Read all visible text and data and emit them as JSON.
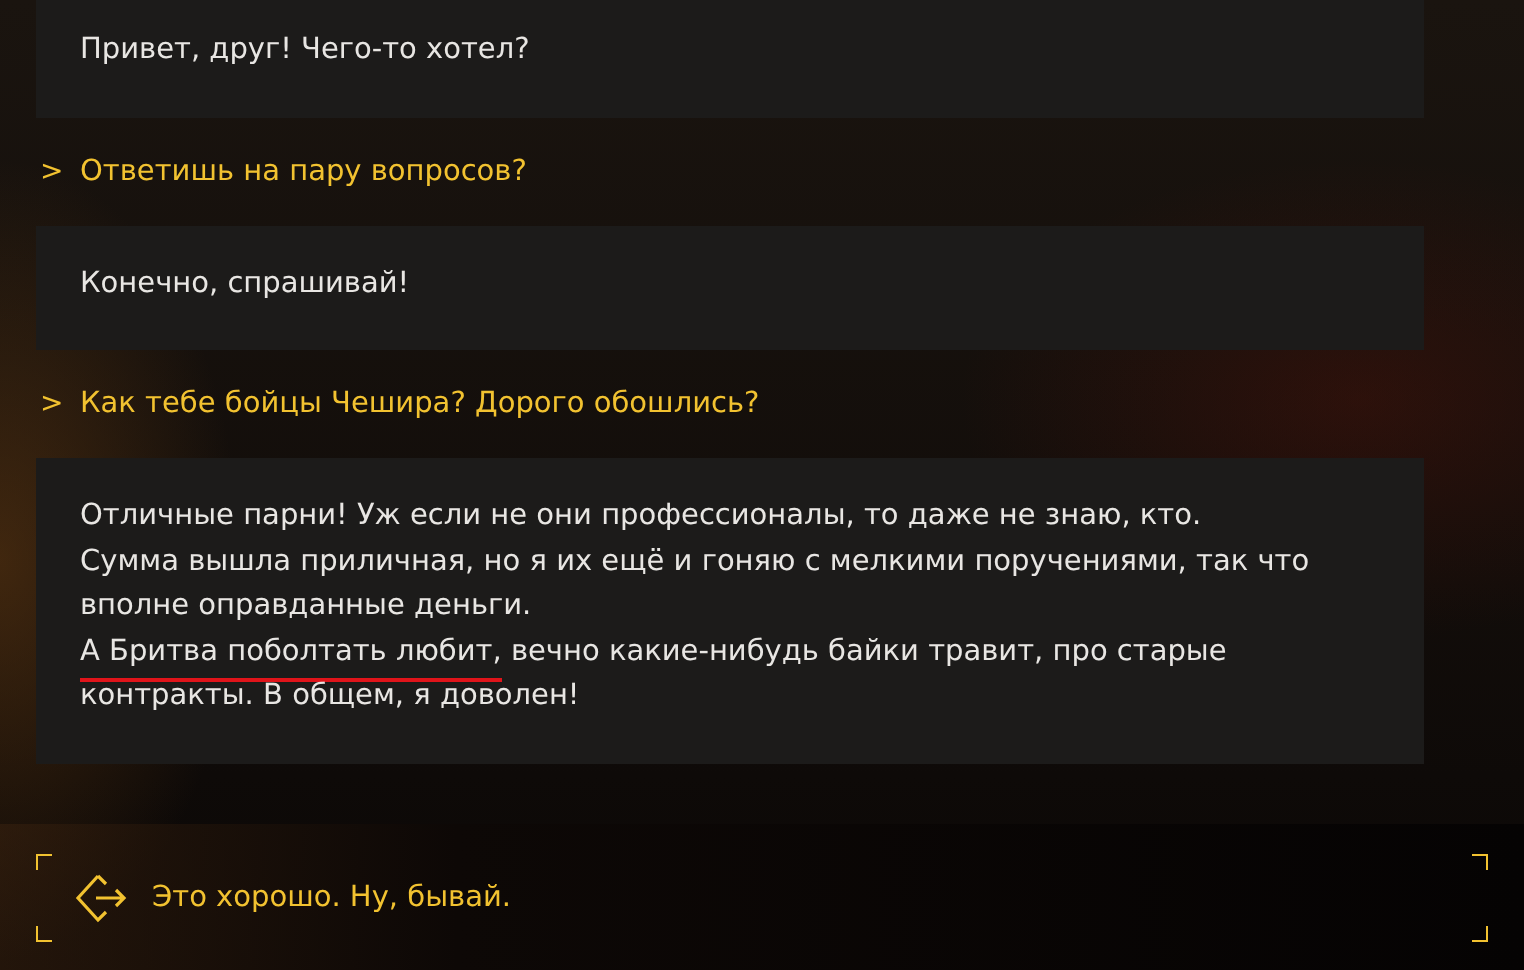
{
  "dialogue": [
    {
      "kind": "npc",
      "lines": [
        [
          {
            "text": "Привет, друг! Чего-то хотел?",
            "underlined": false
          }
        ]
      ]
    },
    {
      "kind": "player",
      "marker": ">",
      "text": "Ответишь на пару вопросов?"
    },
    {
      "kind": "npc",
      "lines": [
        [
          {
            "text": "Конечно, спрашивай!",
            "underlined": false
          }
        ]
      ]
    },
    {
      "kind": "player",
      "marker": ">",
      "text": "Как тебе бойцы Чешира? Дорого обошлись?"
    },
    {
      "kind": "npc",
      "lines": [
        [
          {
            "text": "Отличные парни! Уж если не они профессионалы, то даже не знаю, кто.",
            "underlined": false
          }
        ],
        [
          {
            "text": "Сумма вышла приличная, но я их ещё и гоняю с мелкими поручениями, так что",
            "underlined": false
          }
        ],
        [
          {
            "text": "вполне оправданные деньги.",
            "underlined": false
          }
        ],
        [
          {
            "text": "А Бритва поболтать любит,",
            "underlined": true
          },
          {
            "text": " вечно какие-нибудь байки травит, про старые",
            "underlined": false
          }
        ],
        [
          {
            "text": "контракты. В общем, я доволен!",
            "underlined": false
          }
        ]
      ]
    }
  ],
  "choice": {
    "text": "Это хорошо. Ну, бывай.",
    "selected": true
  }
}
